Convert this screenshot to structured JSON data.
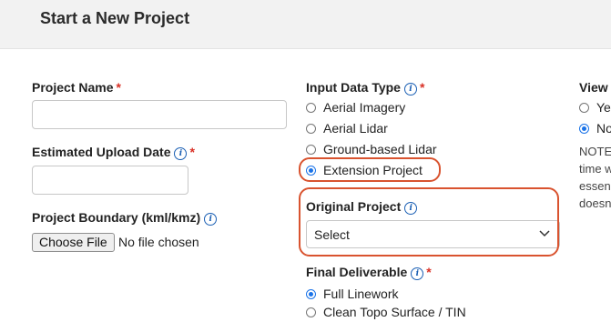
{
  "header": {
    "title": "Start a New Project"
  },
  "form": {
    "project_name_label": "Project Name",
    "project_name_value": "",
    "upload_date_label": "Estimated Upload Date",
    "upload_date_value": "",
    "boundary_label": "Project Boundary (kml/kmz)",
    "choose_file_label": "Choose File",
    "no_file_text": "No file chosen",
    "input_type_label": "Input Data Type",
    "input_types": [
      {
        "label": "Aerial Imagery",
        "checked": false
      },
      {
        "label": "Aerial Lidar",
        "checked": false
      },
      {
        "label": "Ground-based Lidar",
        "checked": false
      },
      {
        "label": "Extension Project",
        "checked": true
      }
    ],
    "original_project_label": "Original Project",
    "original_project_value": "Select",
    "final_deliverable_label": "Final Deliverable",
    "deliverables": [
      {
        "label": "Full Linework",
        "checked": true
      },
      {
        "label": "Clean Topo Surface / TIN",
        "checked": false
      }
    ],
    "required_mark": "*",
    "info_glyph": "i"
  },
  "right_column": {
    "heading": "View",
    "options": [
      {
        "label": "Yes",
        "checked": false
      },
      {
        "label": "No",
        "checked": true
      }
    ],
    "note_lines": [
      "NOTE",
      "time w",
      "essen",
      "doesn"
    ]
  },
  "colors": {
    "highlight": "#d9532f",
    "accent": "#1a73e8",
    "required": "#d93025"
  }
}
